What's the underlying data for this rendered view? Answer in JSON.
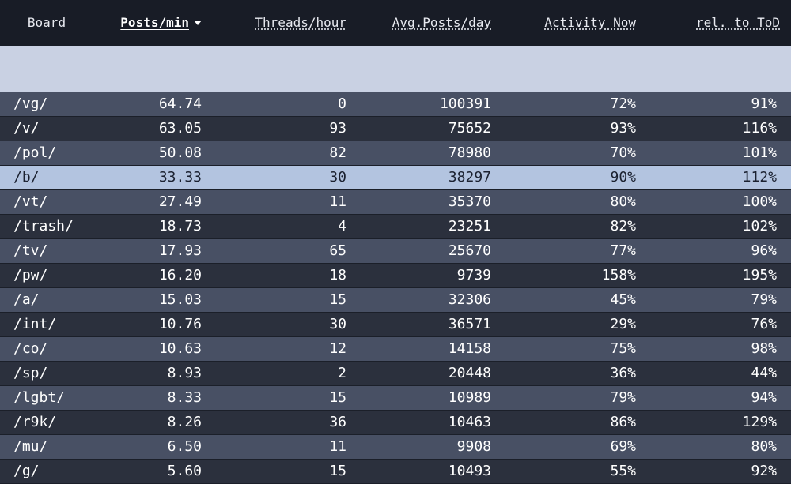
{
  "columns": {
    "board": "Board",
    "posts_per_min": "Posts/min",
    "threads_per_hour": "Threads/hour",
    "avg_posts_per_day": "Avg.Posts/day",
    "activity_now": "Activity Now",
    "rel_to_tod": "rel. to ToD"
  },
  "sorted_by": "posts_per_min",
  "highlighted_row": "/b/",
  "colors": {
    "header_bg": "#181c26",
    "row_odd": "#485064",
    "row_even": "#2b303d",
    "row_highlight": "#b3c4e0"
  },
  "rows": [
    {
      "board": "/vg/",
      "posts_per_min": "64.74",
      "threads_per_hour": "0",
      "avg_posts_per_day": "100391",
      "activity_now": "72%",
      "rel_to_tod": "91%"
    },
    {
      "board": "/v/",
      "posts_per_min": "63.05",
      "threads_per_hour": "93",
      "avg_posts_per_day": "75652",
      "activity_now": "93%",
      "rel_to_tod": "116%"
    },
    {
      "board": "/pol/",
      "posts_per_min": "50.08",
      "threads_per_hour": "82",
      "avg_posts_per_day": "78980",
      "activity_now": "70%",
      "rel_to_tod": "101%"
    },
    {
      "board": "/b/",
      "posts_per_min": "33.33",
      "threads_per_hour": "30",
      "avg_posts_per_day": "38297",
      "activity_now": "90%",
      "rel_to_tod": "112%"
    },
    {
      "board": "/vt/",
      "posts_per_min": "27.49",
      "threads_per_hour": "11",
      "avg_posts_per_day": "35370",
      "activity_now": "80%",
      "rel_to_tod": "100%"
    },
    {
      "board": "/trash/",
      "posts_per_min": "18.73",
      "threads_per_hour": "4",
      "avg_posts_per_day": "23251",
      "activity_now": "82%",
      "rel_to_tod": "102%"
    },
    {
      "board": "/tv/",
      "posts_per_min": "17.93",
      "threads_per_hour": "65",
      "avg_posts_per_day": "25670",
      "activity_now": "77%",
      "rel_to_tod": "96%"
    },
    {
      "board": "/pw/",
      "posts_per_min": "16.20",
      "threads_per_hour": "18",
      "avg_posts_per_day": "9739",
      "activity_now": "158%",
      "rel_to_tod": "195%"
    },
    {
      "board": "/a/",
      "posts_per_min": "15.03",
      "threads_per_hour": "15",
      "avg_posts_per_day": "32306",
      "activity_now": "45%",
      "rel_to_tod": "79%"
    },
    {
      "board": "/int/",
      "posts_per_min": "10.76",
      "threads_per_hour": "30",
      "avg_posts_per_day": "36571",
      "activity_now": "29%",
      "rel_to_tod": "76%"
    },
    {
      "board": "/co/",
      "posts_per_min": "10.63",
      "threads_per_hour": "12",
      "avg_posts_per_day": "14158",
      "activity_now": "75%",
      "rel_to_tod": "98%"
    },
    {
      "board": "/sp/",
      "posts_per_min": "8.93",
      "threads_per_hour": "2",
      "avg_posts_per_day": "20448",
      "activity_now": "36%",
      "rel_to_tod": "44%"
    },
    {
      "board": "/lgbt/",
      "posts_per_min": "8.33",
      "threads_per_hour": "15",
      "avg_posts_per_day": "10989",
      "activity_now": "79%",
      "rel_to_tod": "94%"
    },
    {
      "board": "/r9k/",
      "posts_per_min": "8.26",
      "threads_per_hour": "36",
      "avg_posts_per_day": "10463",
      "activity_now": "86%",
      "rel_to_tod": "129%"
    },
    {
      "board": "/mu/",
      "posts_per_min": "6.50",
      "threads_per_hour": "11",
      "avg_posts_per_day": "9908",
      "activity_now": "69%",
      "rel_to_tod": "80%"
    },
    {
      "board": "/g/",
      "posts_per_min": "5.60",
      "threads_per_hour": "15",
      "avg_posts_per_day": "10493",
      "activity_now": "55%",
      "rel_to_tod": "92%"
    }
  ]
}
